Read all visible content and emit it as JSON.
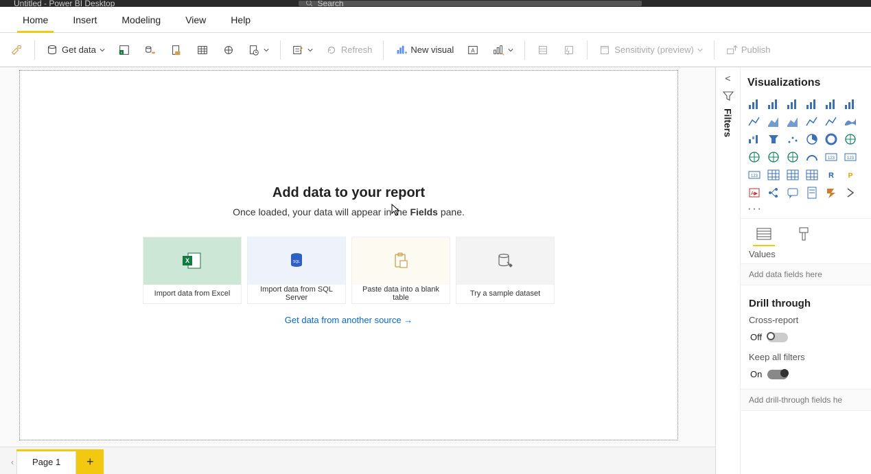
{
  "titlebar": {
    "app_title": "Untitled - Power BI Desktop",
    "search_placeholder": "Search"
  },
  "tabs": {
    "items": [
      "Home",
      "Insert",
      "Modeling",
      "View",
      "Help"
    ],
    "active_index": 0
  },
  "ribbon": {
    "get_data": "Get data",
    "refresh": "Refresh",
    "new_visual": "New visual",
    "sensitivity": "Sensitivity (preview)",
    "publish": "Publish"
  },
  "canvas": {
    "heading": "Add data to your report",
    "subtitle_pre": "Once loaded, your data will appear in the ",
    "subtitle_bold": "Fields",
    "subtitle_post": " pane.",
    "cards": [
      {
        "id": "excel",
        "label": "Import data from Excel"
      },
      {
        "id": "sql",
        "label": "Import data from SQL Server"
      },
      {
        "id": "paste",
        "label": "Paste data into a blank table"
      },
      {
        "id": "sample",
        "label": "Try a sample dataset"
      }
    ],
    "another_source": "Get data from another source →"
  },
  "pagetabs": {
    "pages": [
      "Page 1"
    ],
    "active_index": 0
  },
  "filters_label": "Filters",
  "viz": {
    "title": "Visualizations",
    "icons": [
      "stacked-bar",
      "clustered-bar",
      "stacked-column",
      "clustered-column",
      "stacked-bar-100",
      "stacked-column-100",
      "line",
      "area",
      "stacked-area",
      "line-clustered",
      "line-stacked",
      "ribbon",
      "waterfall",
      "funnel",
      "scatter",
      "pie",
      "donut",
      "treemap",
      "map",
      "filled-map",
      "shape-map",
      "gauge",
      "card",
      "multi-card",
      "kpi",
      "slicer",
      "table",
      "matrix",
      "r-visual",
      "py-visual",
      "key-influencers",
      "decomp-tree",
      "qna",
      "paginated",
      "power-automate",
      "more"
    ],
    "more": "···",
    "values_label": "Values",
    "values_placeholder": "Add data fields here",
    "drill_title": "Drill through",
    "cross_report_label": "Cross-report",
    "cross_report_state": "Off",
    "keep_filters_label": "Keep all filters",
    "keep_filters_state": "On",
    "drill_placeholder": "Add drill-through fields he"
  }
}
